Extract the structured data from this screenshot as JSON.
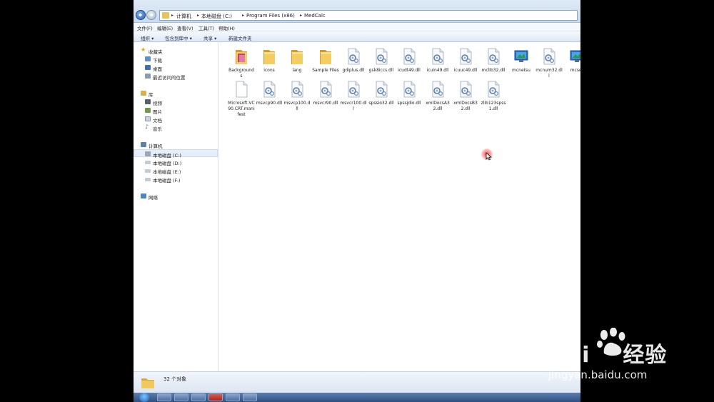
{
  "address": {
    "crumbs": [
      "计算机",
      "本地磁盘 (C:)",
      "Program Files (x86)",
      "MedCalc"
    ]
  },
  "menu": [
    "文件(F)",
    "编辑(E)",
    "查看(V)",
    "工具(T)",
    "帮助(H)"
  ],
  "toolbar": {
    "organize": "组织 ▾",
    "include": "包含到库中 ▾",
    "share": "共享 ▾",
    "new_folder": "新建文件夹"
  },
  "nav": {
    "favorites": "收藏夹",
    "downloads": "下载",
    "desktop": "桌面",
    "recent": "最近访问的位置",
    "libraries": "库",
    "videos": "视频",
    "pictures": "图片",
    "documents": "文档",
    "music": "音乐",
    "computer": "计算机",
    "drive_c": "本地磁盘 (C:)",
    "drive_d": "本地磁盘 (D:)",
    "drive_e": "本地磁盘 (E:)",
    "drive_f": "本地磁盘 (F:)",
    "network": "网络"
  },
  "files": [
    {
      "name": "Backgrounds",
      "type": "folder-pink"
    },
    {
      "name": "icons",
      "type": "folder"
    },
    {
      "name": "lang",
      "type": "folder"
    },
    {
      "name": "Sample Files",
      "type": "folder"
    },
    {
      "name": "gdiplus.dll",
      "type": "dll"
    },
    {
      "name": "gsk8iccs.dll",
      "type": "dll"
    },
    {
      "name": "icudt49.dll",
      "type": "dll"
    },
    {
      "name": "icuin49.dll",
      "type": "dll"
    },
    {
      "name": "icuuc49.dll",
      "type": "dll"
    },
    {
      "name": "mclib32.dll",
      "type": "dll"
    },
    {
      "name": "mcnetsu",
      "type": "exe"
    },
    {
      "name": "mcnum32.dll",
      "type": "dll"
    },
    {
      "name": "mcser",
      "type": "exe"
    },
    {
      "name": "Microsoft.VC90.CRT.manifest",
      "type": "doc"
    },
    {
      "name": "msvcp90.dll",
      "type": "dll"
    },
    {
      "name": "msvcp100.dll",
      "type": "dll"
    },
    {
      "name": "msvcr90.dll",
      "type": "dll"
    },
    {
      "name": "msvcr100.dll",
      "type": "dll"
    },
    {
      "name": "spssio32.dll",
      "type": "dll"
    },
    {
      "name": "spssjdio.dll",
      "type": "dll"
    },
    {
      "name": "xmlDocsA32.dll",
      "type": "dll"
    },
    {
      "name": "xmlDocsB32.dll",
      "type": "dll"
    },
    {
      "name": "zlib123spss1.dll",
      "type": "dll"
    }
  ],
  "status": {
    "count": "32 个对象"
  },
  "watermark": {
    "brand": "Bai",
    "brand2": "经验",
    "url": "jingyan.baidu.com"
  },
  "colors": {
    "folder": "#e8c25a",
    "accent": "#2a62b0"
  }
}
